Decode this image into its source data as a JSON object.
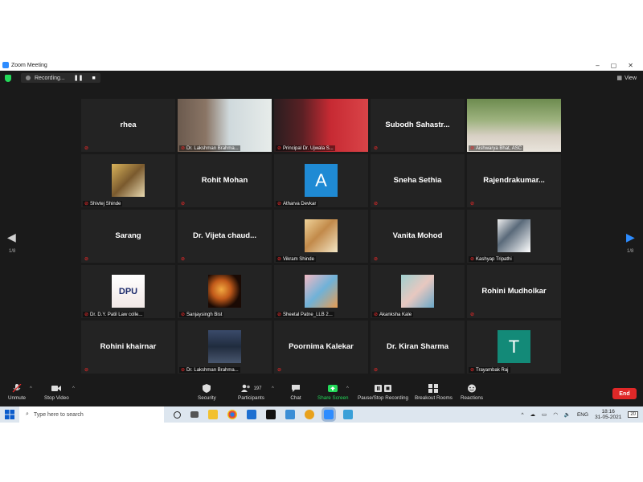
{
  "window": {
    "title": "Zoom Meeting"
  },
  "recording": {
    "label": "Recording...",
    "pause": "❚❚",
    "stop": "■"
  },
  "view_label": "View",
  "page_indicator_left": "1/8",
  "page_indicator_right": "1/8",
  "tiles": [
    {
      "type": "name",
      "big": "rhea",
      "label": ""
    },
    {
      "type": "video",
      "big": "",
      "label": "Dr. Lakshman Brahma..."
    },
    {
      "type": "video",
      "big": "",
      "label": "Principal Dr. Ujwala S..."
    },
    {
      "type": "name",
      "big": "Subodh Sahastr...",
      "label": ""
    },
    {
      "type": "video",
      "big": "",
      "label": "Aishwarya Bhat, ASC"
    },
    {
      "type": "photo",
      "big": "",
      "label": "Shivtej Shinde"
    },
    {
      "type": "name",
      "big": "Rohit Mohan",
      "label": ""
    },
    {
      "type": "letter",
      "big": "A",
      "label": "Atharva Devkar"
    },
    {
      "type": "name",
      "big": "Sneha Sethia",
      "label": ""
    },
    {
      "type": "name",
      "big": "Rajendrakumar...",
      "label": ""
    },
    {
      "type": "name",
      "big": "Sarang",
      "label": ""
    },
    {
      "type": "name",
      "big": "Dr. Vijeta chaud...",
      "label": ""
    },
    {
      "type": "photo",
      "big": "",
      "label": "Vikram Shinde"
    },
    {
      "type": "name",
      "big": "Vanita Mohod",
      "label": ""
    },
    {
      "type": "photo",
      "big": "",
      "label": "Kashyap Tripathi"
    },
    {
      "type": "photo",
      "big": "",
      "label": "Dr. D.Y. Patil Law colle..."
    },
    {
      "type": "photo",
      "big": "",
      "label": "Sanjaysingh Bist"
    },
    {
      "type": "photo",
      "big": "",
      "label": "Sheetal Patne_LLB 2..."
    },
    {
      "type": "photo",
      "big": "",
      "label": "Akanksha Kale"
    },
    {
      "type": "name",
      "big": "Rohini Mudholkar",
      "label": ""
    },
    {
      "type": "name",
      "big": "Rohini khairnar",
      "label": ""
    },
    {
      "type": "photo",
      "big": "",
      "label": "Dr. Lakshman Brahma..."
    },
    {
      "type": "name",
      "big": "Poornima Kalekar",
      "label": ""
    },
    {
      "type": "name",
      "big": "Dr. Kiran Sharma",
      "label": ""
    },
    {
      "type": "letter",
      "big": "T",
      "label": "Trayambak Raj"
    }
  ],
  "toolbar": {
    "unmute": "Unmute",
    "stop_video": "Stop Video",
    "security": "Security",
    "participants": "Participants",
    "participants_count": "197",
    "chat": "Chat",
    "share_screen": "Share Screen",
    "pause_recording": "Pause/Stop Recording",
    "breakout_rooms": "Breakout Rooms",
    "reactions": "Reactions",
    "end": "End"
  },
  "taskbar": {
    "search_placeholder": "Type here to search",
    "lang": "ENG",
    "time": "18:16",
    "date": "31-05-2021",
    "notif_count": "20"
  },
  "colors": {
    "accent_blue": "#2d8cff",
    "end_red": "#e02828",
    "active_speaker": "#ffd23f",
    "letter_A": "#1f8ad4",
    "letter_T": "#138a78"
  }
}
